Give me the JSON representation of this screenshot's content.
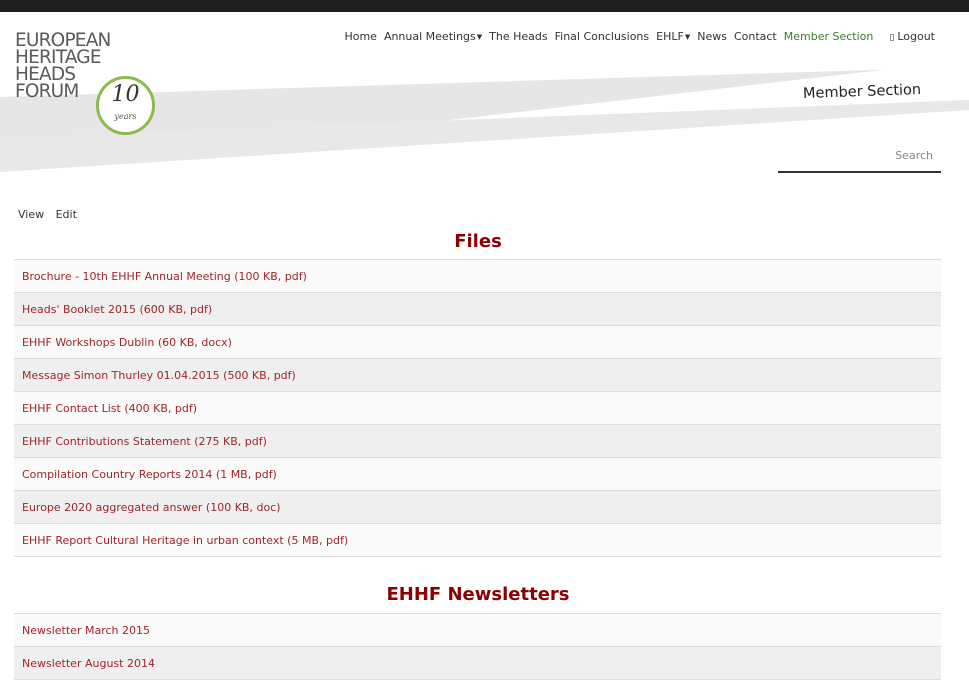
{
  "logo": {
    "lines": [
      "EUROPEAN",
      "HERITAGE",
      "HEADS",
      "FORUM"
    ],
    "badge_number": "10",
    "badge_text": "years"
  },
  "nav": [
    {
      "label": "Home"
    },
    {
      "label": "Annual Meetings",
      "dropdown": true
    },
    {
      "label": "The Heads"
    },
    {
      "label": "Final Conclusions"
    },
    {
      "label": "EHLF",
      "dropdown": true
    },
    {
      "label": "News"
    },
    {
      "label": "Contact"
    },
    {
      "label": "Member Section",
      "active": true
    },
    {
      "label": "Logout",
      "icon": "logout-icon"
    }
  ],
  "page_heading": "Member Section",
  "search": {
    "placeholder": "Search"
  },
  "tabs": [
    "View",
    "Edit"
  ],
  "files": {
    "title": "Files",
    "items": [
      "Brochure - 10th EHHF Annual Meeting (100 KB, pdf)",
      "Heads' Booklet 2015 (600 KB, pdf)",
      "EHHF Workshops Dublin (60 KB, docx)",
      "Message Simon Thurley 01.04.2015 (500 KB, pdf)",
      "EHHF Contact List (400 KB, pdf)",
      "EHHF Contributions Statement (275 KB, pdf)",
      "Compilation Country Reports 2014 (1 MB, pdf)",
      "Europe 2020 aggregated answer (100 KB, doc)",
      "EHHF Report Cultural Heritage in urban context (5 MB, pdf)"
    ]
  },
  "newsletters": {
    "title": "EHHF Newsletters",
    "items": [
      "Newsletter March 2015",
      "Newsletter August 2014"
    ]
  },
  "colors": {
    "accent_red": "#8b0000",
    "link_red": "#a0252a",
    "active_green": "#3b7c2c",
    "badge_green": "#8dbb4a"
  }
}
